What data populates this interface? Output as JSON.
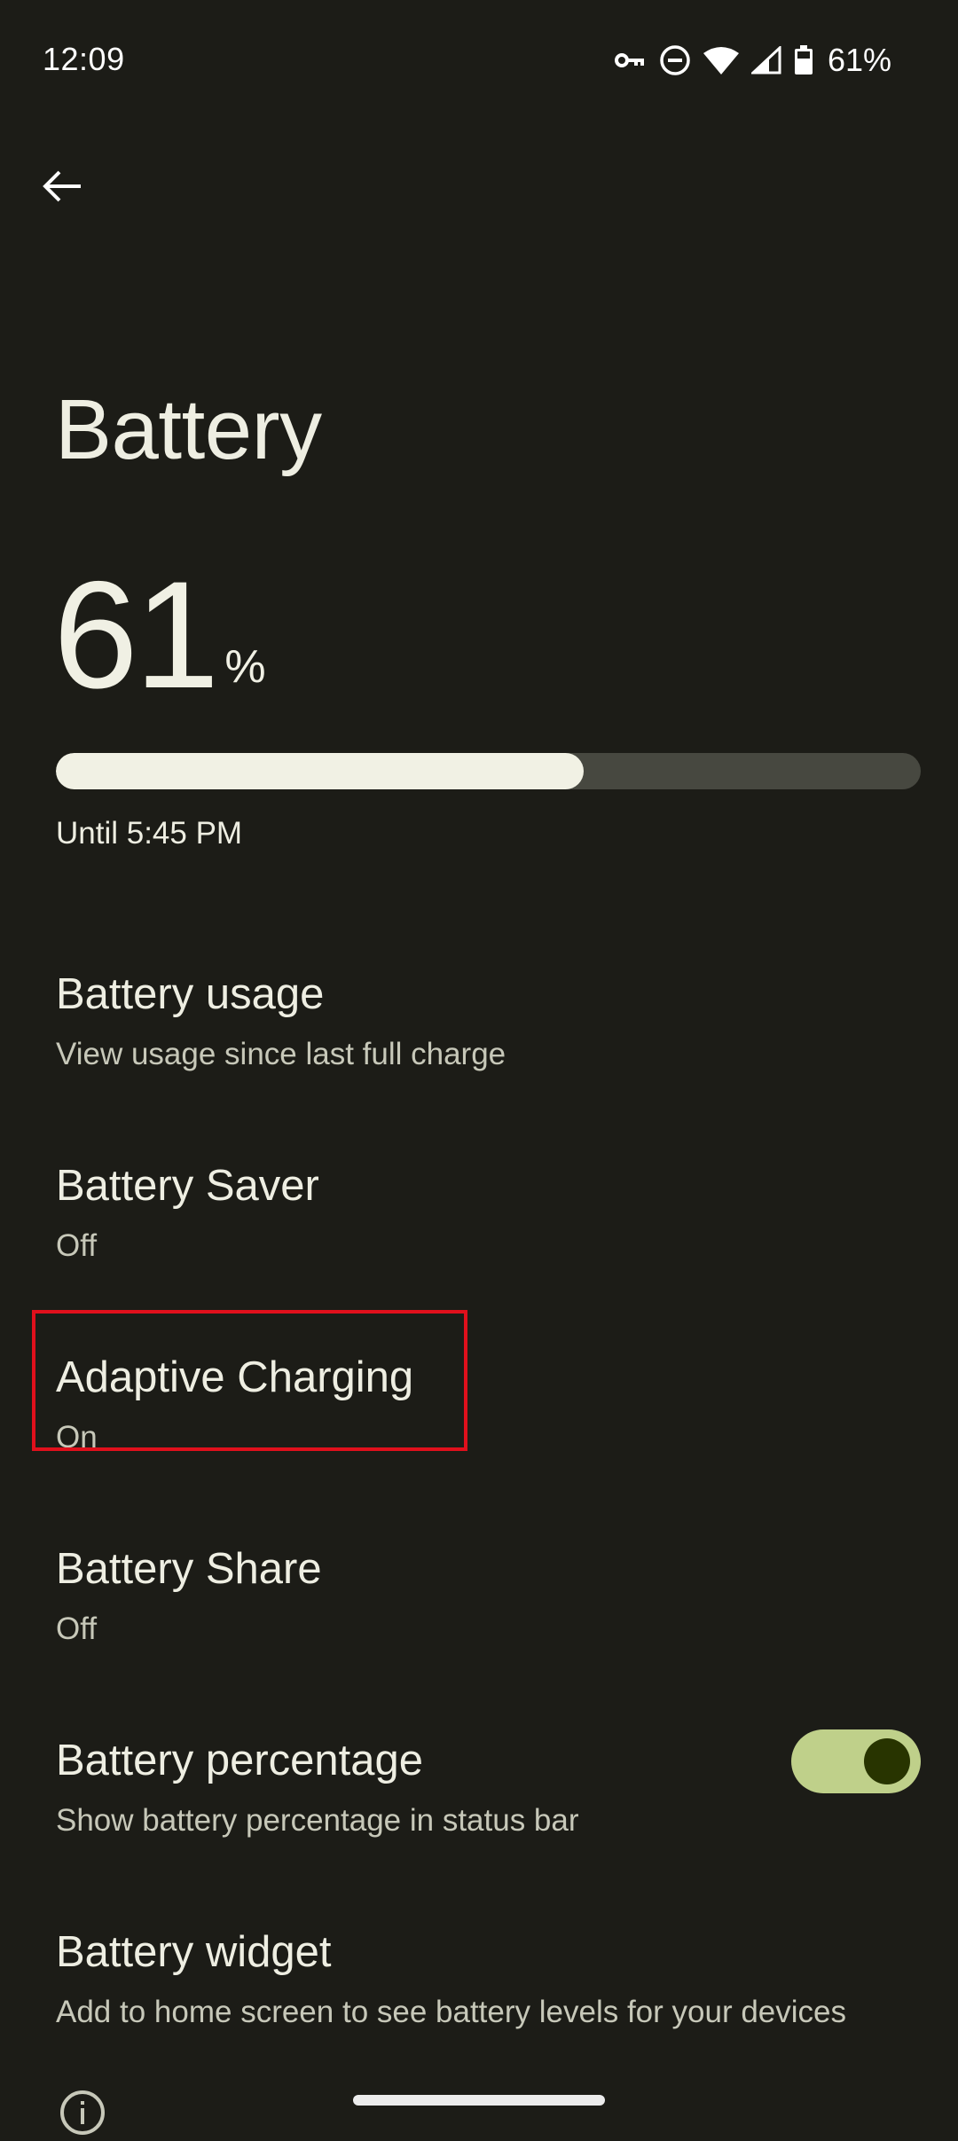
{
  "status_bar": {
    "time": "12:09",
    "icons": [
      "vpn-key-icon",
      "do-not-disturb-icon",
      "wifi-icon",
      "cell-signal-icon",
      "battery-icon"
    ],
    "battery_percent": "61%"
  },
  "header": {
    "back_icon": "arrow-back-icon",
    "title": "Battery"
  },
  "battery": {
    "level": "61",
    "level_sign": "%",
    "level_fraction": 0.61,
    "estimate": "Until 5:45 PM"
  },
  "items": [
    {
      "title": "Battery usage",
      "subtitle": "View usage since last full charge"
    },
    {
      "title": "Battery Saver",
      "subtitle": "Off"
    },
    {
      "title": "Adaptive Charging",
      "subtitle": "On",
      "highlighted": true
    },
    {
      "title": "Battery Share",
      "subtitle": "Off"
    },
    {
      "title": "Battery percentage",
      "subtitle": "Show battery percentage in status bar",
      "toggle": true,
      "toggle_on": true
    },
    {
      "title": "Battery widget",
      "subtitle": "Add to home screen to see battery levels for your devices"
    }
  ],
  "footer": {
    "info_icon": "info-icon"
  },
  "colors": {
    "background": "#1c1c17",
    "progress_fill": "#f1f1e4",
    "progress_track": "#474840",
    "toggle_track": "#bfd08a",
    "toggle_thumb": "#283400",
    "highlight": "#e0101c"
  }
}
